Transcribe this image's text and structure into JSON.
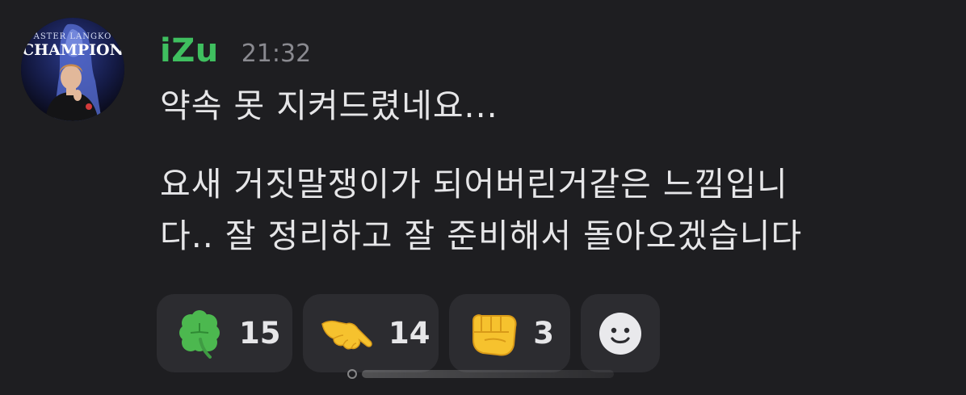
{
  "message": {
    "avatar": {
      "image_text": "CHAMPION"
    },
    "username": "iZu",
    "timestamp": "21:32",
    "lines": [
      "약속 못 지켜드렸네요...",
      "요새 거짓말쟁이가 되어버린거같은 느낌입니",
      "다.. 잘 정리하고 잘 준비해서 돌아오겠습니다"
    ]
  },
  "reactions": [
    {
      "emoji": "four-leaf-clover-icon",
      "count": "15"
    },
    {
      "emoji": "pointing-hand-icon",
      "count": "14"
    },
    {
      "emoji": "fist-icon",
      "count": "3"
    }
  ],
  "add_reaction": {
    "icon": "smiley-icon"
  },
  "colors": {
    "background": "#1e1e21",
    "username": "#3fbf5f",
    "timestamp": "#8a8a90",
    "text": "#e6e6e8",
    "reaction_bg": "#2c2c30"
  }
}
